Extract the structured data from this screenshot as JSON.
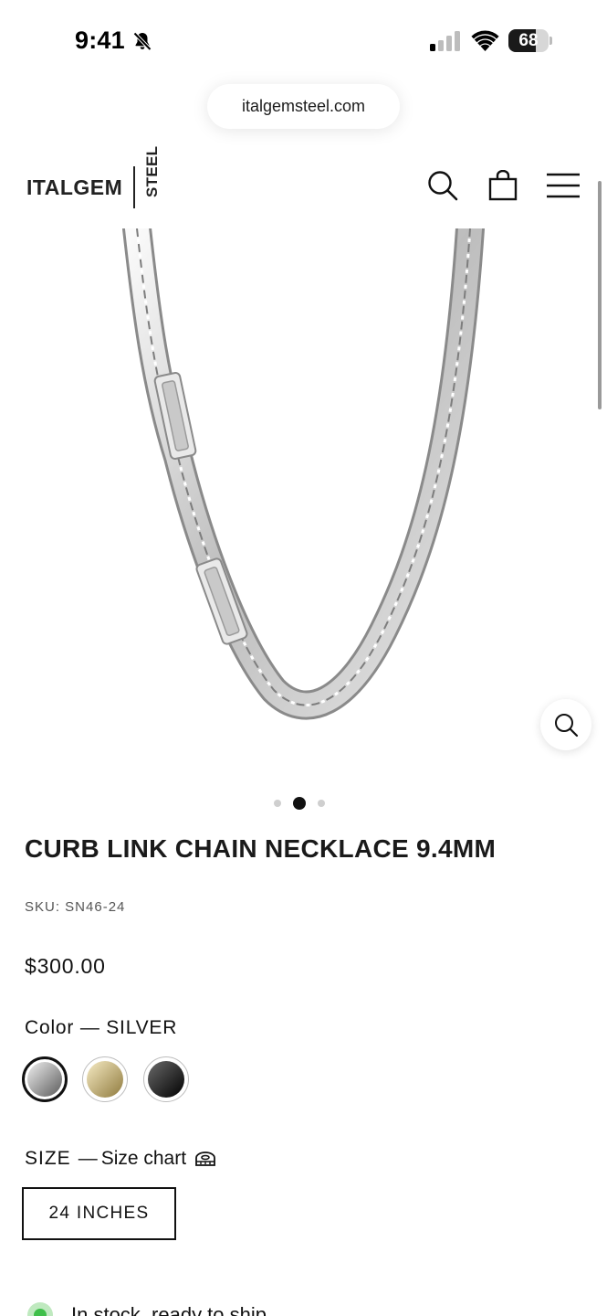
{
  "status_bar": {
    "time": "9:41",
    "battery_level": "68",
    "battery_fraction": 0.68,
    "icons": [
      "bell-slash-icon",
      "cellular-signal-icon",
      "wifi-icon",
      "battery-icon"
    ]
  },
  "browser": {
    "url": "italgemsteel.com"
  },
  "header": {
    "logo_main": "ITALGEM",
    "logo_sub": "STEEL",
    "icons": [
      "search-icon",
      "shopping-bag-icon",
      "hamburger-menu-icon"
    ]
  },
  "gallery": {
    "image_count": 3,
    "active_index": 1,
    "zoom_icon": "magnifier-icon"
  },
  "product": {
    "title": "CURB LINK CHAIN NECKLACE 9.4MM",
    "sku": "SKU: SN46-24",
    "price": "$300.00"
  },
  "color": {
    "label": "Color — SILVER",
    "options": [
      {
        "name": "silver",
        "gradient_from": "#f1f1f1",
        "gradient_to": "#5a5a5a",
        "selected": true
      },
      {
        "name": "gold",
        "gradient_from": "#f6ebc4",
        "gradient_to": "#8f7a3d",
        "selected": false
      },
      {
        "name": "black",
        "gradient_from": "#6a6a6a",
        "gradient_to": "#000000",
        "selected": false
      }
    ]
  },
  "size": {
    "label": "SIZE",
    "separator": "—",
    "chart_link": "Size chart",
    "chart_icon": "ruler-icon",
    "selected": "24 INCHES"
  },
  "stock": {
    "text": "In stock, ready to ship"
  }
}
